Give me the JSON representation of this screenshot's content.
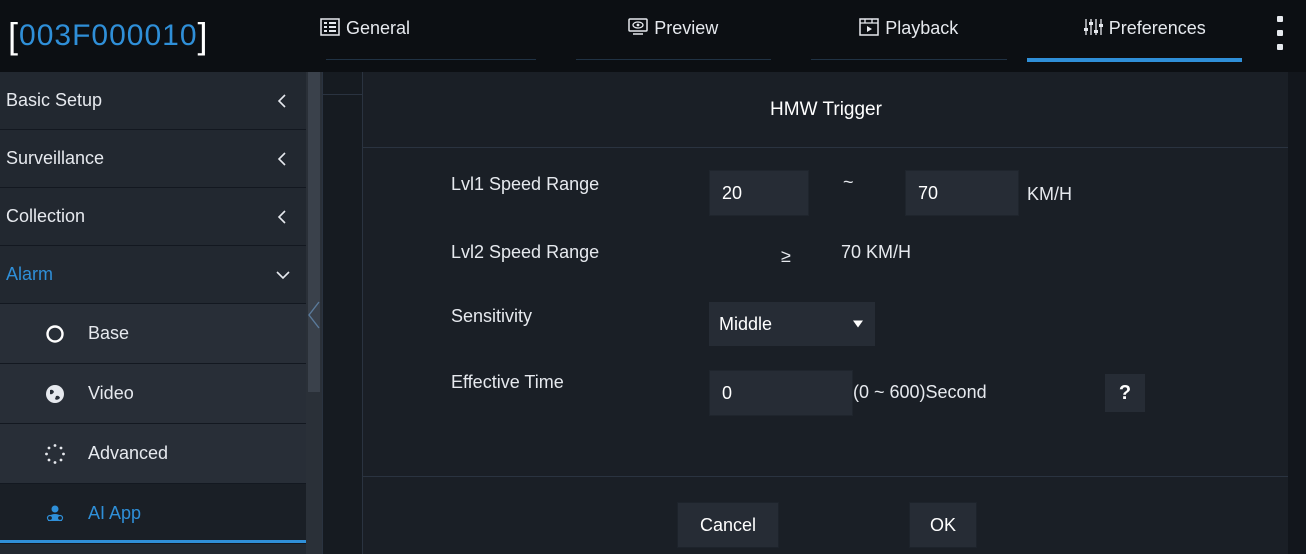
{
  "header": {
    "device_id": "003F000010",
    "tabs": [
      {
        "label": "General",
        "icon": "grid-list-icon",
        "active": false
      },
      {
        "label": "Preview",
        "icon": "monitor-eye-icon",
        "active": false
      },
      {
        "label": "Playback",
        "icon": "film-play-icon",
        "active": false
      },
      {
        "label": "Preferences",
        "icon": "sliders-icon",
        "active": true
      }
    ],
    "menu_icon": "kebab-menu-icon"
  },
  "sidebar": {
    "items": [
      {
        "label": "Basic Setup",
        "icon": "chevron-left-icon"
      },
      {
        "label": "Surveillance",
        "icon": "chevron-left-icon"
      },
      {
        "label": "Collection",
        "icon": "chevron-left-icon"
      },
      {
        "label": "Alarm",
        "icon": "chevron-down-icon",
        "expanded": true
      }
    ],
    "sub_items": [
      {
        "label": "Base",
        "icon": "circle-icon"
      },
      {
        "label": "Video",
        "icon": "globe-icon"
      },
      {
        "label": "Advanced",
        "icon": "dots-spinner-icon"
      },
      {
        "label": "AI App",
        "icon": "people-icon",
        "active": true
      }
    ],
    "accent_color": "#2f8fd8"
  },
  "panel": {
    "title": "HMW Trigger",
    "lvl1": {
      "label": "Lvl1 Speed Range",
      "min": "20",
      "separator": "~",
      "max": "70",
      "unit": "KM/H"
    },
    "lvl2": {
      "label": "Lvl2 Speed Range",
      "operator": "≥",
      "value": "70 KM/H"
    },
    "sensitivity": {
      "label": "Sensitivity",
      "value": "Middle"
    },
    "effective_time": {
      "label": "Effective Time",
      "value": "0",
      "range": "(0 ~ 600)Second",
      "help": "?"
    },
    "buttons": {
      "cancel": "Cancel",
      "ok": "OK"
    }
  }
}
